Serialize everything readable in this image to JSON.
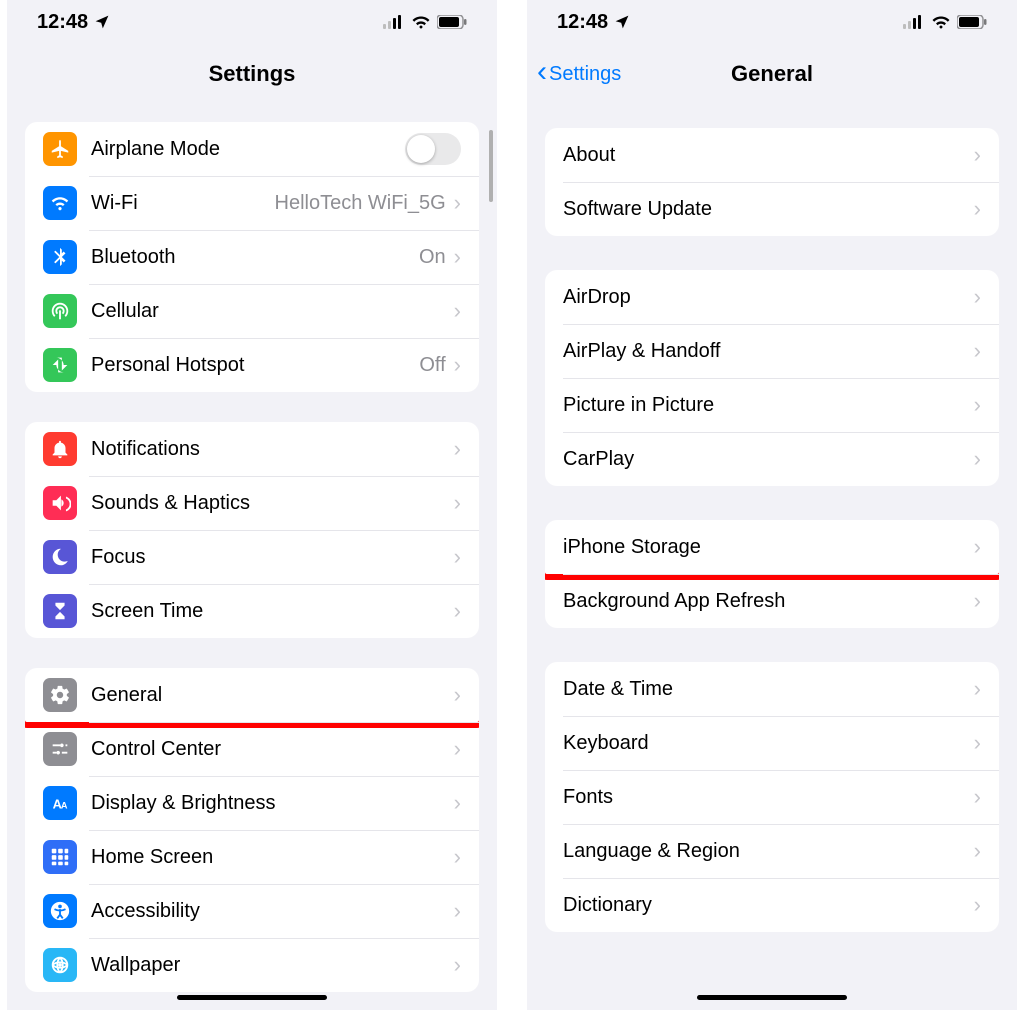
{
  "status": {
    "time": "12:48"
  },
  "left": {
    "title": "Settings",
    "groups": [
      [
        {
          "icon": "airplane",
          "color": "ic-orange",
          "label": "Airplane Mode",
          "control": "toggle"
        },
        {
          "icon": "wifi",
          "color": "ic-blue",
          "label": "Wi-Fi",
          "value": "HelloTech WiFi_5G",
          "chevron": true
        },
        {
          "icon": "bluetooth",
          "color": "ic-blue",
          "label": "Bluetooth",
          "value": "On",
          "chevron": true
        },
        {
          "icon": "cellular",
          "color": "ic-green",
          "label": "Cellular",
          "chevron": true
        },
        {
          "icon": "hotspot",
          "color": "ic-green",
          "label": "Personal Hotspot",
          "value": "Off",
          "chevron": true
        }
      ],
      [
        {
          "icon": "bell",
          "color": "ic-red",
          "label": "Notifications",
          "chevron": true
        },
        {
          "icon": "speaker",
          "color": "ic-pink",
          "label": "Sounds & Haptics",
          "chevron": true
        },
        {
          "icon": "moon",
          "color": "ic-indigo",
          "label": "Focus",
          "chevron": true
        },
        {
          "icon": "hourglass",
          "color": "ic-indigo",
          "label": "Screen Time",
          "chevron": true
        }
      ],
      [
        {
          "icon": "gear",
          "color": "ic-grey",
          "label": "General",
          "chevron": true,
          "highlight": true
        },
        {
          "icon": "sliders",
          "color": "ic-grey",
          "label": "Control Center",
          "chevron": true
        },
        {
          "icon": "textsize",
          "color": "ic-blue",
          "label": "Display & Brightness",
          "chevron": true
        },
        {
          "icon": "apps",
          "color": "ic-appsblue",
          "label": "Home Screen",
          "chevron": true
        },
        {
          "icon": "access",
          "color": "ic-blue",
          "label": "Accessibility",
          "chevron": true
        },
        {
          "icon": "wallpaper",
          "color": "ic-cyan",
          "label": "Wallpaper",
          "chevron": true
        }
      ]
    ]
  },
  "right": {
    "back": "Settings",
    "title": "General",
    "groups": [
      [
        {
          "label": "About"
        },
        {
          "label": "Software Update"
        }
      ],
      [
        {
          "label": "AirDrop"
        },
        {
          "label": "AirPlay & Handoff"
        },
        {
          "label": "Picture in Picture"
        },
        {
          "label": "CarPlay"
        }
      ],
      [
        {
          "label": "iPhone Storage",
          "highlight": true
        },
        {
          "label": "Background App Refresh"
        }
      ],
      [
        {
          "label": "Date & Time"
        },
        {
          "label": "Keyboard"
        },
        {
          "label": "Fonts"
        },
        {
          "label": "Language & Region"
        },
        {
          "label": "Dictionary"
        }
      ]
    ]
  }
}
